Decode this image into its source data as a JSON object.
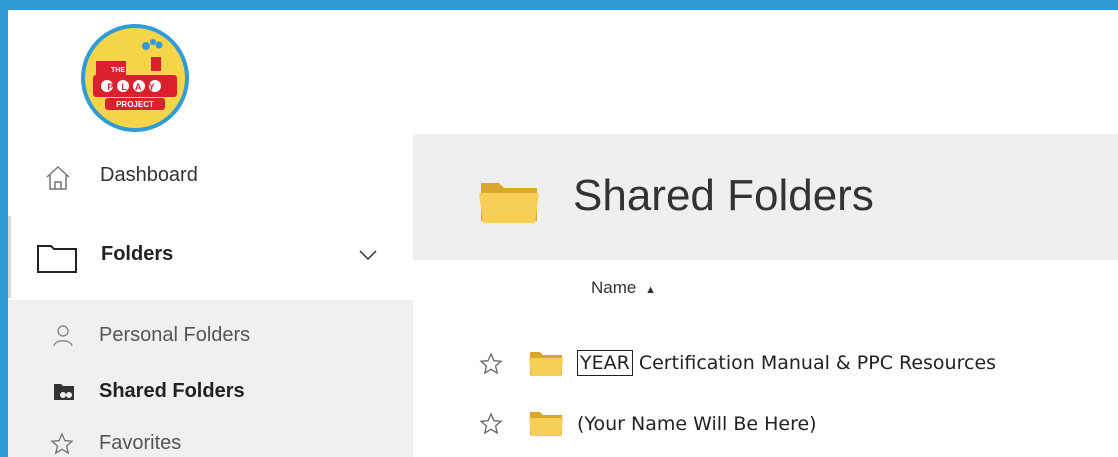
{
  "branding": {
    "logo_top": "THE",
    "logo_main": "PLAY",
    "logo_sub": "PROJECT",
    "frame_color": "#2f9bd7"
  },
  "sidebar": {
    "dashboard_label": "Dashboard",
    "folders_label": "Folders",
    "subitems": [
      {
        "label": "Personal Folders",
        "icon": "user-icon"
      },
      {
        "label": "Shared Folders",
        "icon": "shared-folder-icon"
      },
      {
        "label": "Favorites",
        "icon": "star-icon"
      }
    ]
  },
  "main": {
    "title": "Shared Folders",
    "column_name": "Name",
    "sort_indicator": "▲",
    "rows": [
      {
        "prefix": "YEAR",
        "text": " Certification Manual & PPC Resources"
      },
      {
        "text": "(Your Name Will Be Here)"
      }
    ]
  }
}
